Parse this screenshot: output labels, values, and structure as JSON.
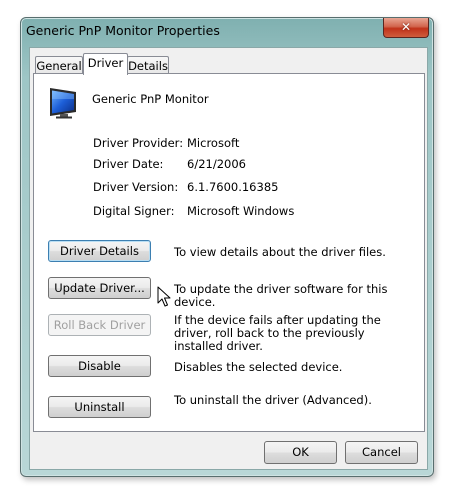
{
  "window": {
    "title": "Generic PnP Monitor Properties",
    "close_label": "✕"
  },
  "tabs": [
    {
      "label": "General"
    },
    {
      "label": "Driver"
    },
    {
      "label": "Details"
    }
  ],
  "device": {
    "name": "Generic PnP Monitor"
  },
  "info": {
    "provider_label": "Driver Provider:",
    "provider_value": "Microsoft",
    "date_label": "Driver Date:",
    "date_value": "6/21/2006",
    "version_label": "Driver Version:",
    "version_value": "6.1.7600.16385",
    "signer_label": "Digital Signer:",
    "signer_value": "Microsoft Windows"
  },
  "actions": {
    "details": {
      "label": "Driver Details",
      "desc": "To view details about the driver files."
    },
    "update": {
      "label": "Update Driver...",
      "desc": "To update the driver software for this device."
    },
    "rollback": {
      "label": "Roll Back Driver",
      "desc": "If the device fails after updating the driver, roll back to the previously installed driver."
    },
    "disable": {
      "label": "Disable",
      "desc": "Disables the selected device."
    },
    "uninstall": {
      "label": "Uninstall",
      "desc": "To uninstall the driver (Advanced)."
    }
  },
  "footer": {
    "ok_label": "OK",
    "cancel_label": "Cancel"
  },
  "icons": {
    "device": "monitor-icon",
    "pointer": "mouse-cursor-icon"
  }
}
